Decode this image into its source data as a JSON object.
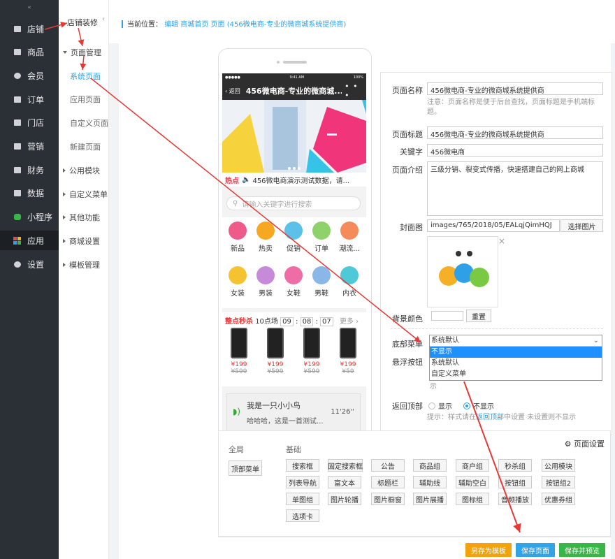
{
  "sidebar": {
    "collapse_label": "«",
    "items": [
      {
        "label": "店铺",
        "icon": "store-icon"
      },
      {
        "label": "商品",
        "icon": "goods-icon"
      },
      {
        "label": "会员",
        "icon": "member-icon"
      },
      {
        "label": "订单",
        "icon": "order-icon"
      },
      {
        "label": "门店",
        "icon": "shop-icon"
      },
      {
        "label": "营销",
        "icon": "marketing-icon"
      },
      {
        "label": "财务",
        "icon": "finance-icon"
      },
      {
        "label": "数据",
        "icon": "data-icon"
      },
      {
        "label": "小程序",
        "icon": "miniprogram-icon"
      },
      {
        "label": "应用",
        "icon": "apps-icon"
      },
      {
        "label": "设置",
        "icon": "settings-icon"
      }
    ]
  },
  "subnav": {
    "title": "店铺装修",
    "collapse": "‹",
    "groups": [
      "页面管理",
      "公用模块",
      "自定义菜单",
      "其他功能",
      "商城设置",
      "模板管理"
    ],
    "pages": [
      "系统页面",
      "应用页面",
      "自定义页面",
      "新建页面"
    ]
  },
  "breadcrumb": {
    "prefix": "当前位置：",
    "path": "编辑 商城首页 页面 (456微电商-专业的微商城系统提供商)"
  },
  "phone": {
    "status_left": "●●●●● ",
    "status_time": "9:41 AM",
    "status_right": "100%",
    "back": "返回",
    "title": "456微电商-专业的微商城...",
    "more": "• • •",
    "notice_hot": "热点",
    "notice_text": "456微电商演示测试数据，请...",
    "search_placeholder": "请输入关键字进行搜索",
    "icons_row1": [
      "新品",
      "热卖",
      "促销",
      "订单",
      "潮流..."
    ],
    "icons_row2": [
      "女装",
      "男装",
      "女鞋",
      "男鞋",
      "内衣"
    ],
    "seckill_label": "整点秒杀",
    "seckill_session": "10点场",
    "seckill_h": "09",
    "seckill_m": "08",
    "seckill_s": "07",
    "seckill_more": "更多 ›",
    "products": [
      {
        "price": "¥199",
        "old_price": "¥599"
      },
      {
        "price": "¥199",
        "old_price": "¥599"
      },
      {
        "price": "¥199",
        "old_price": "¥599"
      },
      {
        "price": "¥199",
        "old_price": "¥59"
      }
    ],
    "voice_title": "我是一只小小鸟",
    "voice_sub": "哈哈哈，这是一首测试...",
    "voice_time": "11'26''"
  },
  "form": {
    "page_name_label": "页面名称",
    "page_name_value": "456微电商-专业的微商城系统提供商",
    "page_name_note": "注意：页面名称是便于后台查找，页面标题是手机端标题。",
    "page_title_label": "页面标题",
    "page_title_value": "456微电商-专业的微商城系统提供商",
    "keyword_label": "关键字",
    "keyword_value": "456微电商",
    "intro_label": "页面介绍",
    "intro_value": "三级分销、裂变式传播，快速搭建自己的网上商城",
    "cover_label": "封面图",
    "cover_value": "images/765/2018/05/EALqjQimHQJ",
    "cover_btn": "选择图片",
    "cover_close": "×",
    "bg_label": "背景颜色",
    "bg_reset": "重置",
    "bottom_menu_label": "底部菜单",
    "bottom_menu_value": "系统默认",
    "bottom_menu_options": [
      "不显示",
      "系统默认",
      "自定义菜单"
    ],
    "float_btn_label": "悬浮按钮",
    "float_btn_tail": "示",
    "back_top_label": "返回顶部",
    "radio_show": "显示",
    "radio_hide": "不显示",
    "back_top_note_a": "提示：样式请在",
    "back_top_note_link": "返回顶部",
    "back_top_note_b": "中设置 未设置则不显示"
  },
  "palette": {
    "global_label": "全局",
    "base_label": "基础",
    "page_settings": "页面设置",
    "global_btn": "顶部菜单",
    "widgets": [
      "搜索框",
      "固定搜索框",
      "公告",
      "商品组",
      "商户组",
      "秒杀组",
      "公用模块",
      "列表导航",
      "富文本",
      "标题栏",
      "辅助线",
      "辅助空白",
      "按钮组",
      "按钮组2",
      "单图组",
      "图片轮播",
      "图片橱窗",
      "图片展播",
      "图标组",
      "音频播放",
      "优惠券组",
      "选项卡"
    ]
  },
  "footer": {
    "save_template": "另存为模板",
    "save_page": "保存页面",
    "save_preview": "保存并预览",
    "colors": {
      "template": "#f0a30a",
      "save": "#33a3e3",
      "preview": "#3bb54a"
    }
  }
}
